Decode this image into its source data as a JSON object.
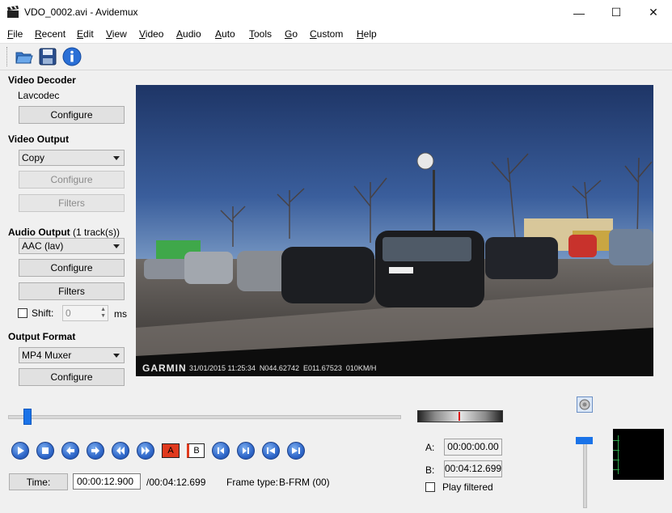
{
  "window": {
    "title": "VDO_0002.avi - Avidemux",
    "minimize_glyph": "—",
    "maximize_glyph": "☐",
    "close_glyph": "✕"
  },
  "menu": [
    "File",
    "Recent",
    "Edit",
    "View",
    "Video",
    "Audio",
    "Auto",
    "Tools",
    "Go",
    "Custom",
    "Help"
  ],
  "toolbar": {
    "icons": [
      "open-folder-icon",
      "save-disk-icon",
      "info-icon"
    ]
  },
  "video_decoder": {
    "title": "Video Decoder",
    "codec": "Lavcodec",
    "configure_label": "Configure"
  },
  "video_output": {
    "title": "Video Output",
    "selected": "Copy",
    "configure_label": "Configure",
    "filters_label": "Filters"
  },
  "audio_output": {
    "title": "Audio Output",
    "tracks": "(1 track(s))",
    "selected": "AAC (lav)",
    "configure_label": "Configure",
    "filters_label": "Filters",
    "shift_label": "Shift:",
    "shift_value": "0",
    "shift_unit": "ms"
  },
  "output_format": {
    "title": "Output Format",
    "selected": "MP4 Muxer",
    "configure_label": "Configure"
  },
  "video_frame": {
    "overlay_brand": "GARMIN",
    "overlay_text": "31/01/2015 11:25:34  N044.62742  E011.67523  010KM/H"
  },
  "timeline": {
    "position_fraction": 0.05
  },
  "status": {
    "time_button": "Time:",
    "current_time": "00:00:12.900",
    "total_time": "/00:04:12.699",
    "frame_type_label": "Frame type:",
    "frame_type_value": "B-FRM (00)"
  },
  "markers": {
    "a_label": "A:",
    "a_value": "00:00:00.00",
    "b_label": "B:",
    "b_value": "00:04:12.699",
    "play_filtered_label": "Play filtered"
  },
  "transport_buttons": [
    "play",
    "stop",
    "prev-frame",
    "next-frame",
    "prev-keyframe",
    "next-keyframe",
    "set-marker-a",
    "set-marker-b",
    "goto-marker-a",
    "goto-marker-b",
    "prev-black",
    "next-black"
  ],
  "marker_a_letter": "A",
  "marker_b_letter": "B",
  "colors": {
    "accent": "#2f67c9",
    "marker_red": "#e03a1e",
    "window_bg": "#f0f0f0"
  }
}
